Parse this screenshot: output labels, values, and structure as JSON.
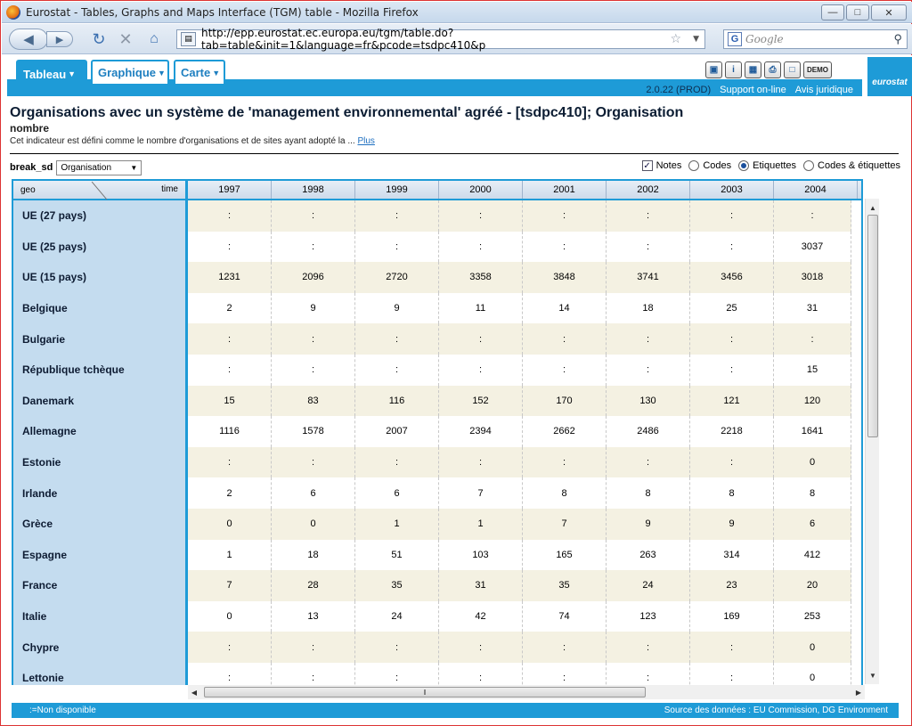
{
  "window": {
    "title": "Eurostat - Tables, Graphs and Maps Interface (TGM) table - Mozilla Firefox"
  },
  "browser": {
    "url": "http://epp.eurostat.ec.europa.eu/tgm/table.do?tab=table&init=1&language=fr&pcode=tsdpc410&p",
    "search_placeholder": "Google"
  },
  "toolbar": {
    "tabs": [
      "Tableau",
      "Graphique",
      "Carte"
    ],
    "demo_label": "DEMO",
    "version": "2.0.22 (PROD)",
    "support": "Support on-line",
    "legal": "Avis juridique",
    "logo": "eurostat"
  },
  "page": {
    "title": "Organisations avec un système de 'management environnemental' agréé - [tsdpc410]; Organisation",
    "subtitle": "nombre",
    "description": "Cet indicateur est défini comme le nombre d'organisations et de sites ayant adopté la ...",
    "more_link": "Plus"
  },
  "controls": {
    "break_label": "break_sd",
    "break_value": "Organisation",
    "notes_label": "Notes",
    "codes_label": "Codes",
    "labels_label": "Etiquettes",
    "codes_labels_label": "Codes & étiquettes"
  },
  "table": {
    "geo_label": "geo",
    "time_label": "time",
    "years": [
      "1997",
      "1998",
      "1999",
      "2000",
      "2001",
      "2002",
      "2003",
      "2004"
    ],
    "rows": [
      {
        "name": "UE (27 pays)",
        "values": [
          ":",
          ":",
          ":",
          ":",
          ":",
          ":",
          ":",
          ":"
        ]
      },
      {
        "name": "UE (25 pays)",
        "values": [
          ":",
          ":",
          ":",
          ":",
          ":",
          ":",
          ":",
          "3037"
        ]
      },
      {
        "name": "UE (15 pays)",
        "values": [
          "1231",
          "2096",
          "2720",
          "3358",
          "3848",
          "3741",
          "3456",
          "3018"
        ]
      },
      {
        "name": "Belgique",
        "values": [
          "2",
          "9",
          "9",
          "11",
          "14",
          "18",
          "25",
          "31"
        ]
      },
      {
        "name": "Bulgarie",
        "values": [
          ":",
          ":",
          ":",
          ":",
          ":",
          ":",
          ":",
          ":"
        ]
      },
      {
        "name": "République tchèque",
        "values": [
          ":",
          ":",
          ":",
          ":",
          ":",
          ":",
          ":",
          "15"
        ]
      },
      {
        "name": "Danemark",
        "values": [
          "15",
          "83",
          "116",
          "152",
          "170",
          "130",
          "121",
          "120"
        ]
      },
      {
        "name": "Allemagne",
        "values": [
          "1116",
          "1578",
          "2007",
          "2394",
          "2662",
          "2486",
          "2218",
          "1641"
        ]
      },
      {
        "name": "Estonie",
        "values": [
          ":",
          ":",
          ":",
          ":",
          ":",
          ":",
          ":",
          "0"
        ]
      },
      {
        "name": "Irlande",
        "values": [
          "2",
          "6",
          "6",
          "7",
          "8",
          "8",
          "8",
          "8"
        ]
      },
      {
        "name": "Grèce",
        "values": [
          "0",
          "0",
          "1",
          "1",
          "7",
          "9",
          "9",
          "6"
        ]
      },
      {
        "name": "Espagne",
        "values": [
          "1",
          "18",
          "51",
          "103",
          "165",
          "263",
          "314",
          "412"
        ]
      },
      {
        "name": "France",
        "values": [
          "7",
          "28",
          "35",
          "31",
          "35",
          "24",
          "23",
          "20"
        ]
      },
      {
        "name": "Italie",
        "values": [
          "0",
          "13",
          "24",
          "42",
          "74",
          "123",
          "169",
          "253"
        ]
      },
      {
        "name": "Chypre",
        "values": [
          ":",
          ":",
          ":",
          ":",
          ":",
          ":",
          ":",
          "0"
        ]
      },
      {
        "name": "Lettonie",
        "values": [
          ":",
          ":",
          ":",
          ":",
          ":",
          ":",
          ":",
          "0"
        ]
      }
    ]
  },
  "footer": {
    "legend": ":=Non disponible",
    "source": "Source des données : EU Commission, DG Environment"
  },
  "colors": {
    "accent": "#1e9bd7",
    "row_header": "#c4dcef",
    "odd_row": "#f4f1e2"
  }
}
